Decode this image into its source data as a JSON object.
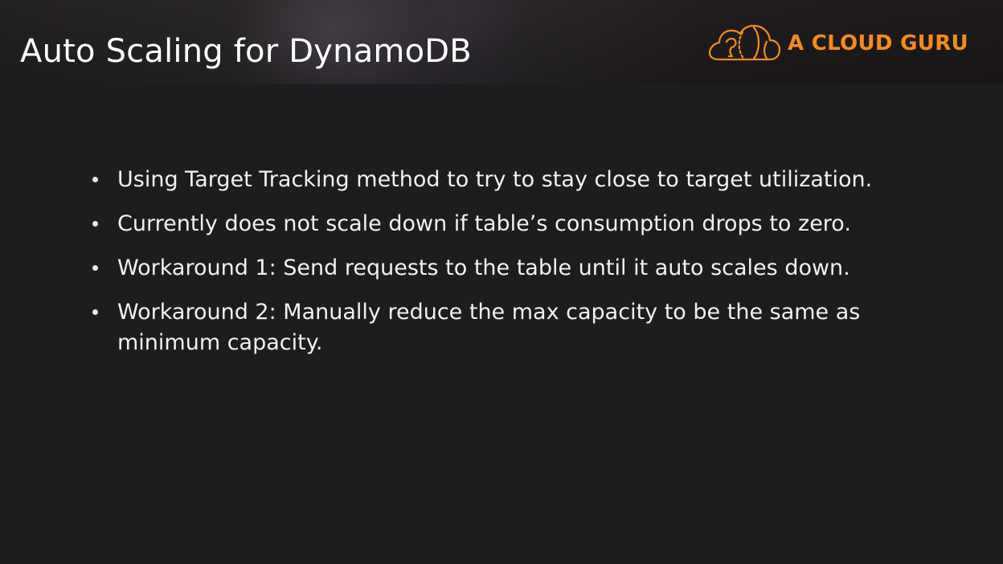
{
  "slide": {
    "title": "Auto Scaling for DynamoDB",
    "logo": {
      "icon": "cloud-logo-icon",
      "text": "A CLOUD GURU",
      "color": "#f28b1f"
    },
    "bullets": [
      "Using Target Tracking method to try to stay close to target utilization.",
      "Currently does not scale down if table’s consumption drops to zero.",
      "Workaround 1: Send requests to the table until it auto scales down.",
      "Workaround 2: Manually reduce the max capacity to be the same as minimum capacity."
    ]
  },
  "colors": {
    "background": "#1d1c1e",
    "text": "#f1f1f1",
    "accent": "#f28b1f"
  }
}
